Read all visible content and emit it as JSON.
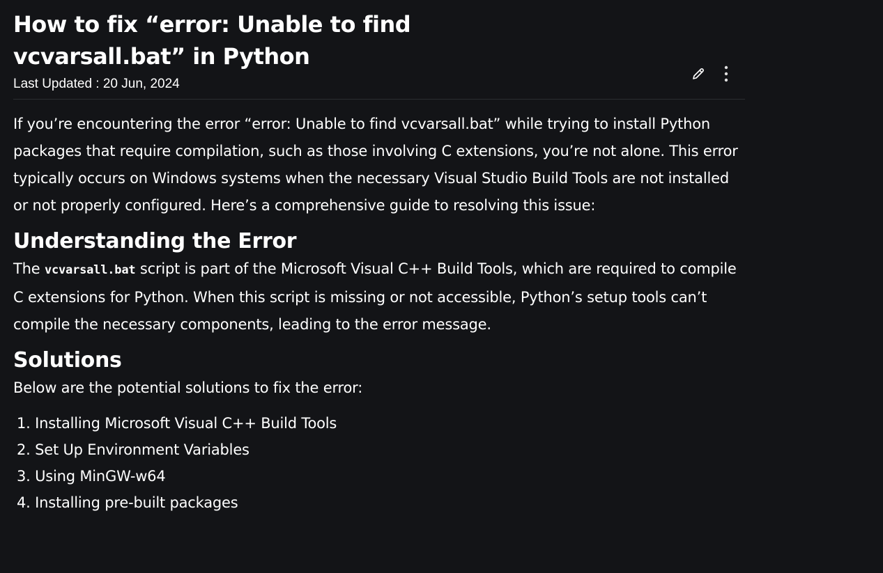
{
  "article": {
    "title": "How to fix “error: Unable to find vcvarsall.bat” in Python",
    "last_updated": "Last Updated : 20 Jun, 2024",
    "intro": "If you’re encountering the error “error: Unable to find vcvarsall.bat” while trying to install Python packages that require compilation, such as those involving C extensions, you’re not alone. This error typically occurs on Windows systems when the necessary Visual Studio Build Tools are not installed or not properly configured. Here’s a comprehensive guide to resolving this issue:",
    "understanding": {
      "heading": "Understanding the Error",
      "text_prefix": "The ",
      "code": "vcvarsall.bat",
      "text_suffix": " script is part of the Microsoft Visual C++ Build Tools, which are required to compile C extensions for Python. When this script is missing or not accessible, Python’s setup tools can’t compile the necessary components, leading to the error message."
    },
    "solutions": {
      "heading": "Solutions",
      "intro": "Below are the potential solutions to fix the error:",
      "items": [
        "1. Installing Microsoft Visual C++ Build Tools",
        "2. Set Up Environment Variables",
        "3. Using MinGW-w64",
        "4. Installing pre-built packages"
      ]
    }
  },
  "icons": {
    "edit": "pencil-icon",
    "more": "kebab-menu-icon"
  }
}
